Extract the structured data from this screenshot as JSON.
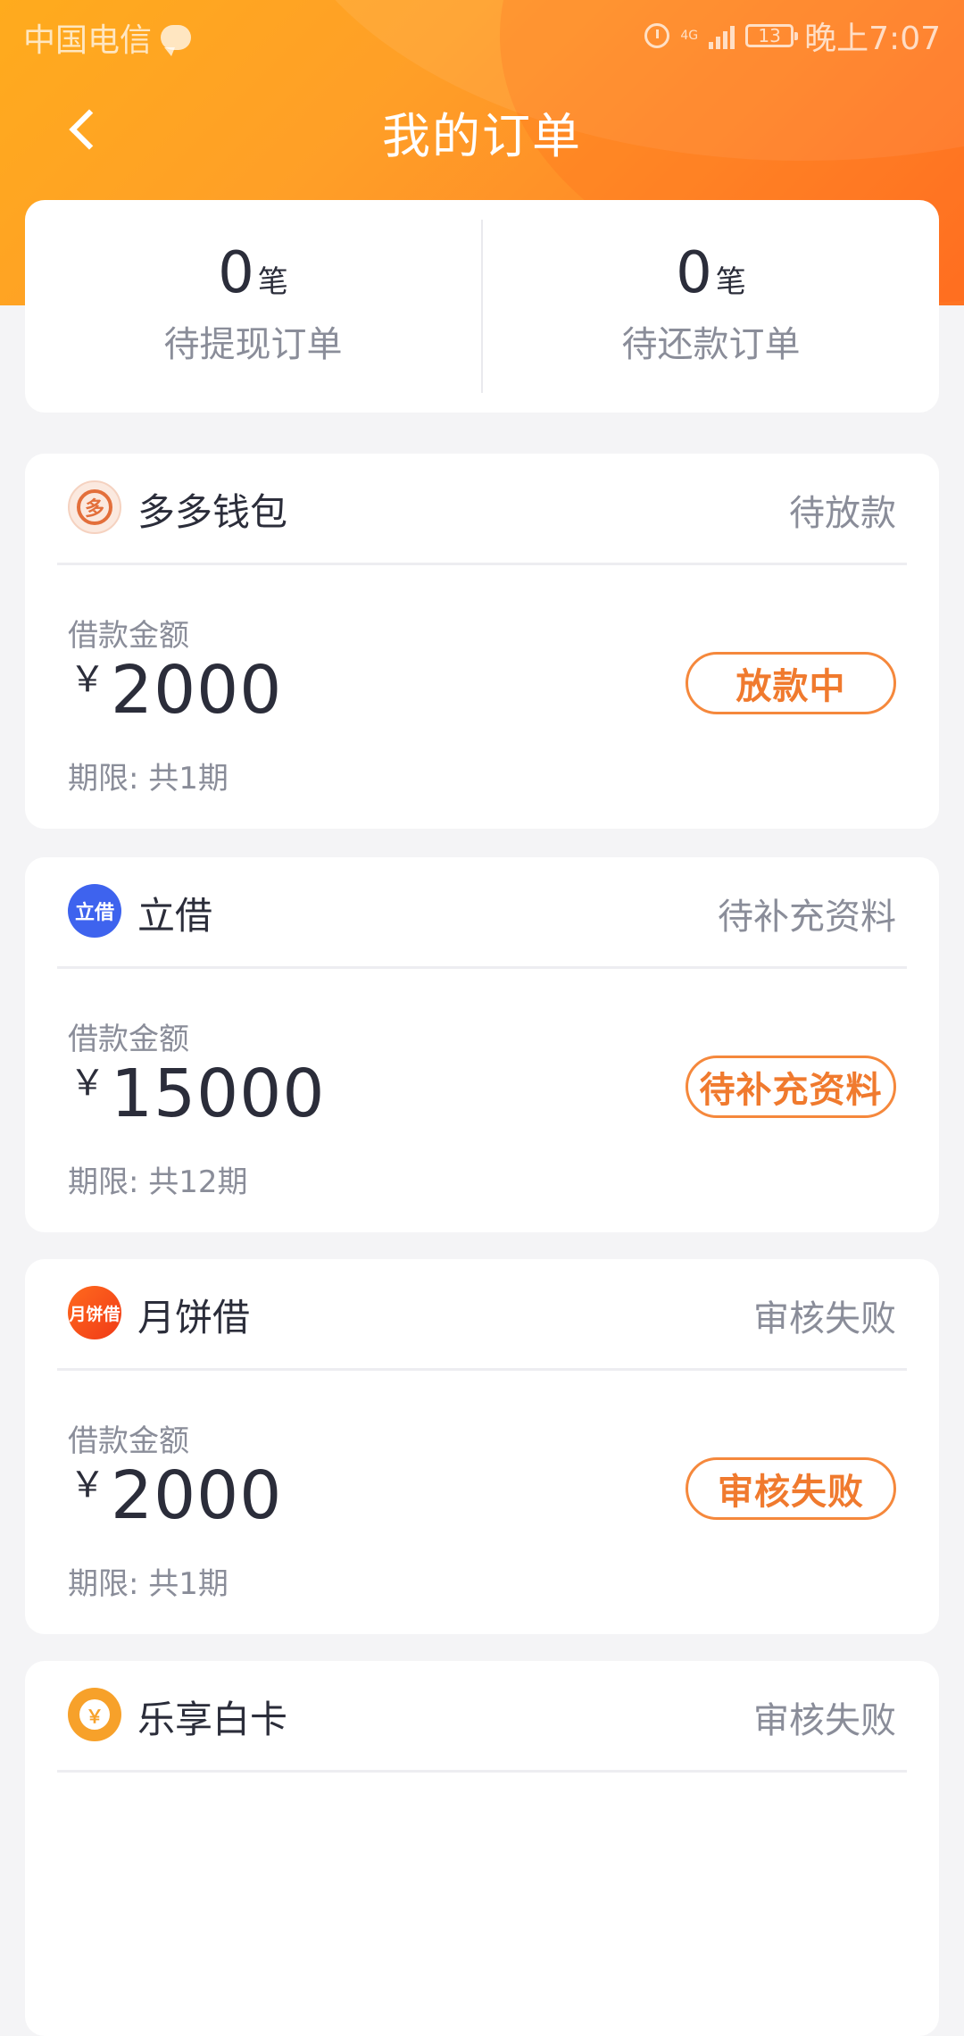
{
  "status_bar": {
    "carrier": "中国电信",
    "network": "4G",
    "battery": "13",
    "time": "晚上7:07"
  },
  "header": {
    "title": "我的订单"
  },
  "summary": {
    "pending_withdraw": {
      "count": "0",
      "unit": "笔",
      "label": "待提现订单"
    },
    "pending_repay": {
      "count": "0",
      "unit": "笔",
      "label": "待还款订单"
    }
  },
  "labels": {
    "amount_label": "借款金额",
    "currency": "￥"
  },
  "orders": [
    {
      "name": "多多钱包",
      "status": "待放款",
      "amount": "2000",
      "term": "期限: 共1期",
      "action": "放款中",
      "logo_text": "多"
    },
    {
      "name": "立借",
      "status": "待补充资料",
      "amount": "15000",
      "term": "期限: 共12期",
      "action": "待补充资料",
      "logo_text": "立借"
    },
    {
      "name": "月饼借",
      "status": "审核失败",
      "amount": "2000",
      "term": "期限: 共1期",
      "action": "审核失败",
      "logo_text": "月饼借"
    },
    {
      "name": "乐享白卡",
      "status": "审核失败",
      "logo_text": "￥"
    }
  ],
  "colors": {
    "accent": "#f07a2e",
    "header_start": "#ffab1d",
    "header_end": "#ff7323",
    "text_primary": "#2b2d3a",
    "text_secondary": "#8a8d99",
    "background": "#f4f4f6"
  }
}
